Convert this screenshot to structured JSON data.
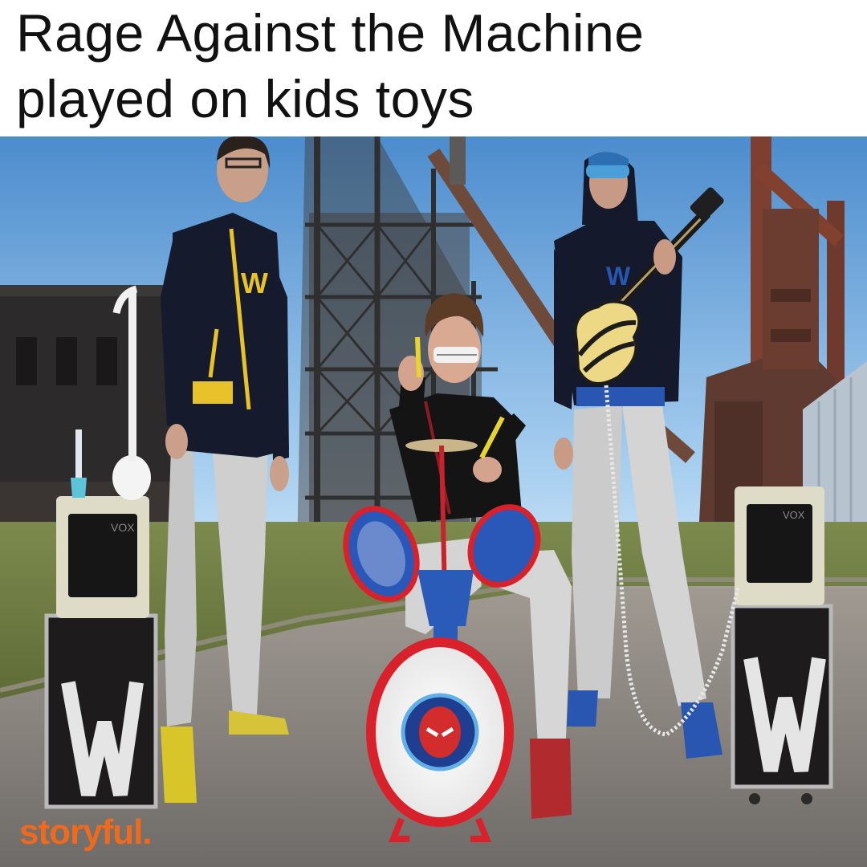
{
  "caption": {
    "line1": "Rage Against the Machine",
    "line2": "played on kids toys"
  },
  "watermark": {
    "text": "storyful."
  },
  "colors": {
    "sky_top": "#4f8fd0",
    "sky_bottom": "#cfe6f8",
    "steel": "#3a3a3a",
    "rust": "#8a4a3a",
    "grass": "#6f7d45",
    "road": "#8a8682",
    "hoodie": "#141c2e",
    "hoodie_yellow": "#e7c22a",
    "jeans": "#c9c9c9",
    "drum_red": "#d8212b",
    "drum_blue": "#2a5bb8",
    "amp_cream": "#e9e6d2",
    "watermark_orange": "#ef6a1d"
  }
}
